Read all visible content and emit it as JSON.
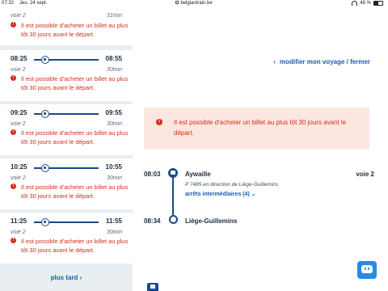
{
  "status_bar": {
    "time": "07:32",
    "date": "Jeu. 24 sept.",
    "url": "belgiantrain.be",
    "battery": "48 %",
    "battery_level": 0.48
  },
  "connections": [
    {
      "departure": "",
      "arrival": "",
      "platform": "voie 2",
      "duration": "31min",
      "warning": "Il est possible d'acheter un billet au plus tôt 30 jours avant le départ."
    },
    {
      "departure": "08:25",
      "arrival": "08:55",
      "platform": "voie 2",
      "duration": "30min",
      "warning": "Il est possible d'acheter un billet au plus tôt 30 jours avant le départ."
    },
    {
      "departure": "09:25",
      "arrival": "09:55",
      "platform": "voie 2",
      "duration": "30min",
      "warning": "Il est possible d'acheter un billet au plus tôt 30 jours avant le départ."
    },
    {
      "departure": "10:25",
      "arrival": "10:55",
      "platform": "voie 2",
      "duration": "30min",
      "warning": "Il est possible d'acheter un billet au plus tôt 30 jours avant le départ."
    },
    {
      "departure": "11:25",
      "arrival": "11:55",
      "platform": "voie 2",
      "duration": "30min",
      "warning": "Il est possible d'acheter un billet au plus tôt 30 jours avant le départ."
    }
  ],
  "more_link": "plus tard",
  "modify_link": "modifier mon voyage / fermer",
  "alert": "Il est possible d'acheter un billet au plus tôt 30 jours avant le départ.",
  "journey": {
    "departure_time": "08:03",
    "from_station": "Aywaille",
    "platform": "voie 2",
    "train_info": "P 7485 en direction de Liège-Guillemins",
    "intermediate_stops": "arrêts intermédiaires (4)",
    "arrival_time": "08:34",
    "to_station": "Liège-Guillemins"
  },
  "colors": {
    "accent": "#1a5cb0",
    "warning": "#d22e1a",
    "alert_bg": "#fbe7e0",
    "sidebar_bg": "#e9eef2",
    "chat": "#2a8ae2"
  }
}
